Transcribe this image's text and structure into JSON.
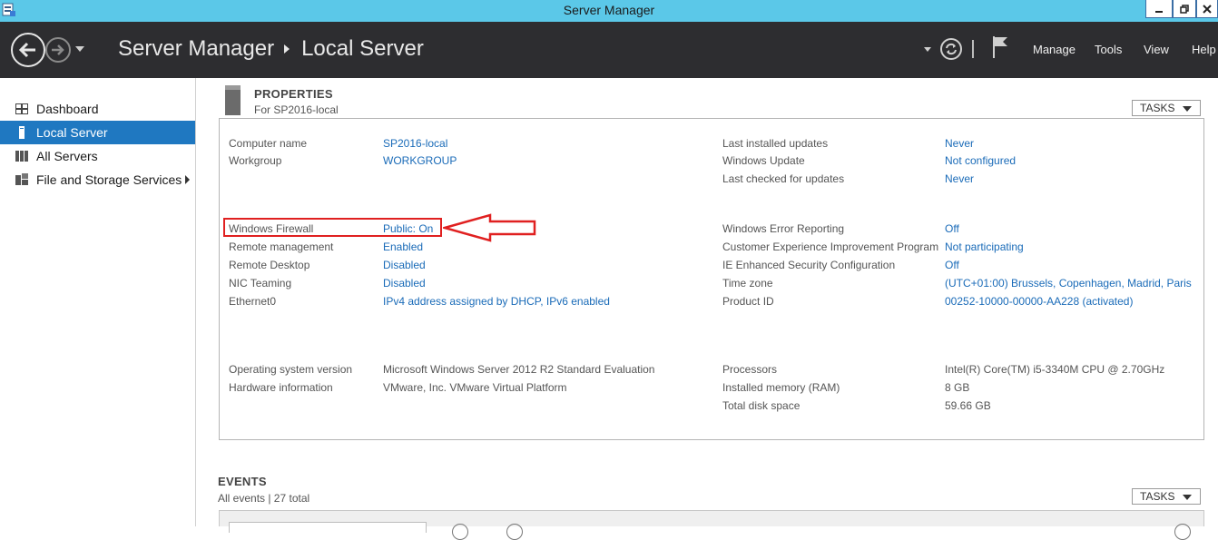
{
  "window": {
    "title": "Server Manager"
  },
  "header": {
    "breadcrumb": [
      "Server Manager",
      "Local Server"
    ],
    "menu": [
      "Manage",
      "Tools",
      "View",
      "Help"
    ]
  },
  "sidebar": {
    "items": [
      {
        "label": "Dashboard",
        "icon": "dashboard-icon",
        "active": false
      },
      {
        "label": "Local Server",
        "icon": "server-icon",
        "active": true
      },
      {
        "label": "All Servers",
        "icon": "all-servers-icon",
        "active": false
      },
      {
        "label": "File and Storage Services",
        "icon": "storage-icon",
        "active": false,
        "has_submenu": true
      }
    ]
  },
  "properties": {
    "title": "PROPERTIES",
    "subtitle": "For SP2016-local",
    "tasks_label": "TASKS",
    "left": [
      {
        "label": "Computer name",
        "value": "SP2016-local",
        "link": true
      },
      {
        "label": "Workgroup",
        "value": "WORKGROUP",
        "link": true
      },
      {
        "label": "Windows Firewall",
        "value": "Public: On",
        "link": true
      },
      {
        "label": "Remote management",
        "value": "Enabled",
        "link": true
      },
      {
        "label": "Remote Desktop",
        "value": "Disabled",
        "link": true
      },
      {
        "label": "NIC Teaming",
        "value": "Disabled",
        "link": true
      },
      {
        "label": "Ethernet0",
        "value": "IPv4 address assigned by DHCP, IPv6 enabled",
        "link": true
      },
      {
        "label": "Operating system version",
        "value": "Microsoft Windows Server 2012 R2 Standard Evaluation",
        "link": false
      },
      {
        "label": "Hardware information",
        "value": "VMware, Inc. VMware Virtual Platform",
        "link": false
      }
    ],
    "right": [
      {
        "label": "Last installed updates",
        "value": "Never",
        "link": true
      },
      {
        "label": "Windows Update",
        "value": "Not configured",
        "link": true
      },
      {
        "label": "Last checked for updates",
        "value": "Never",
        "link": true
      },
      {
        "label": "Windows Error Reporting",
        "value": "Off",
        "link": true
      },
      {
        "label": "Customer Experience Improvement Program",
        "value": "Not participating",
        "link": true
      },
      {
        "label": "IE Enhanced Security Configuration",
        "value": "Off",
        "link": true
      },
      {
        "label": "Time zone",
        "value": "(UTC+01:00) Brussels, Copenhagen, Madrid, Paris",
        "link": true
      },
      {
        "label": "Product ID",
        "value": "00252-10000-00000-AA228 (activated)",
        "link": true
      },
      {
        "label": "Processors",
        "value": "Intel(R) Core(TM) i5-3340M CPU @ 2.70GHz",
        "link": false
      },
      {
        "label": "Installed memory (RAM)",
        "value": "8 GB",
        "link": false
      },
      {
        "label": "Total disk space",
        "value": "59.66 GB",
        "link": false
      }
    ]
  },
  "events": {
    "title": "EVENTS",
    "subtitle": "All events | 27 total",
    "tasks_label": "TASKS"
  },
  "colors": {
    "titlebar": "#5bc8e8",
    "header": "#2d2d30",
    "accent": "#1f78c1",
    "link": "#1a6bb8",
    "highlight": "#e02020"
  }
}
